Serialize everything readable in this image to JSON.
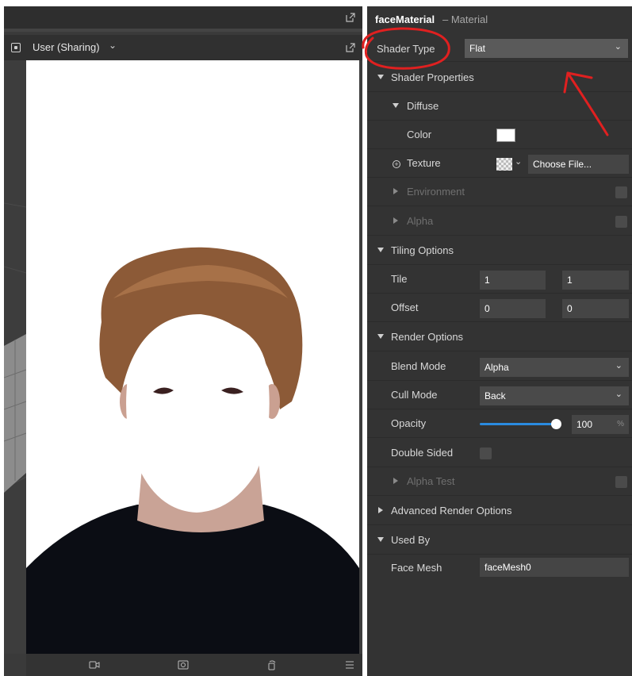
{
  "viewport": {
    "camera_label": "User (Sharing)",
    "icons": [
      "popout-icon",
      "camera-icon",
      "chevron-down-icon",
      "video-record-icon",
      "screenshot-icon",
      "rotate-icon",
      "menu-icon"
    ]
  },
  "inspector": {
    "title": "faceMaterial",
    "subtitle": "– Material",
    "shader_type_label": "Shader Type",
    "shader_type_value": "Flat",
    "shader_properties_label": "Shader Properties",
    "diffuse_label": "Diffuse",
    "color_label": "Color",
    "texture_label": "Texture",
    "choose_file_label": "Choose File...",
    "environment_label": "Environment",
    "alpha_label": "Alpha",
    "tiling_label": "Tiling Options",
    "tile_label": "Tile",
    "tile_x": "1",
    "tile_y": "1",
    "offset_label": "Offset",
    "offset_x": "0",
    "offset_y": "0",
    "render_options_label": "Render Options",
    "blend_mode_label": "Blend Mode",
    "blend_mode_value": "Alpha",
    "cull_mode_label": "Cull Mode",
    "cull_mode_value": "Back",
    "opacity_label": "Opacity",
    "opacity_value": "100",
    "opacity_fraction": 1.0,
    "opacity_unit": "%",
    "double_sided_label": "Double Sided",
    "alpha_test_label": "Alpha Test",
    "advanced_label": "Advanced Render Options",
    "used_by_label": "Used By",
    "face_mesh_label": "Face Mesh",
    "face_mesh_value": "faceMesh0"
  },
  "colors": {
    "panel": "#333333",
    "accent": "#2a8be0",
    "annotation": "#e02020"
  }
}
